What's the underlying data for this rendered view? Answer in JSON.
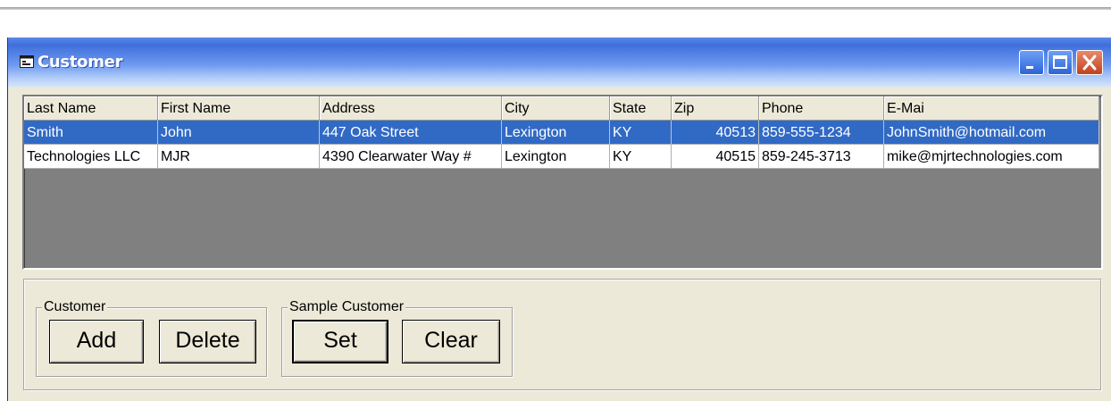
{
  "window": {
    "title": "Customer",
    "icon": "form-window-icon",
    "controls": [
      "minimize",
      "maximize",
      "close"
    ]
  },
  "grid": {
    "columns": [
      "Last Name",
      "First Name",
      "Address",
      "City",
      "State",
      "Zip",
      "Phone",
      "E-Mai"
    ],
    "rows": [
      [
        "Smith",
        "John",
        "447 Oak Street",
        "Lexington",
        "KY",
        "40513",
        "859-555-1234",
        "JohnSmith@hotmail.com"
      ],
      [
        "Technologies LLC",
        "MJR",
        "4390 Clearwater Way #",
        "Lexington",
        "KY",
        "40515",
        "859-245-3713",
        "mike@mjrtechnologies.com"
      ]
    ],
    "selected_row": 0
  },
  "customer_group": {
    "label": "Customer",
    "add_label": "Add",
    "delete_label": "Delete"
  },
  "sample_group": {
    "label": "Sample Customer",
    "set_label": "Set",
    "clear_label": "Clear"
  },
  "colors": {
    "selection": "#316ac5",
    "grid_background": "#808080",
    "form_background": "#ece9d8"
  }
}
